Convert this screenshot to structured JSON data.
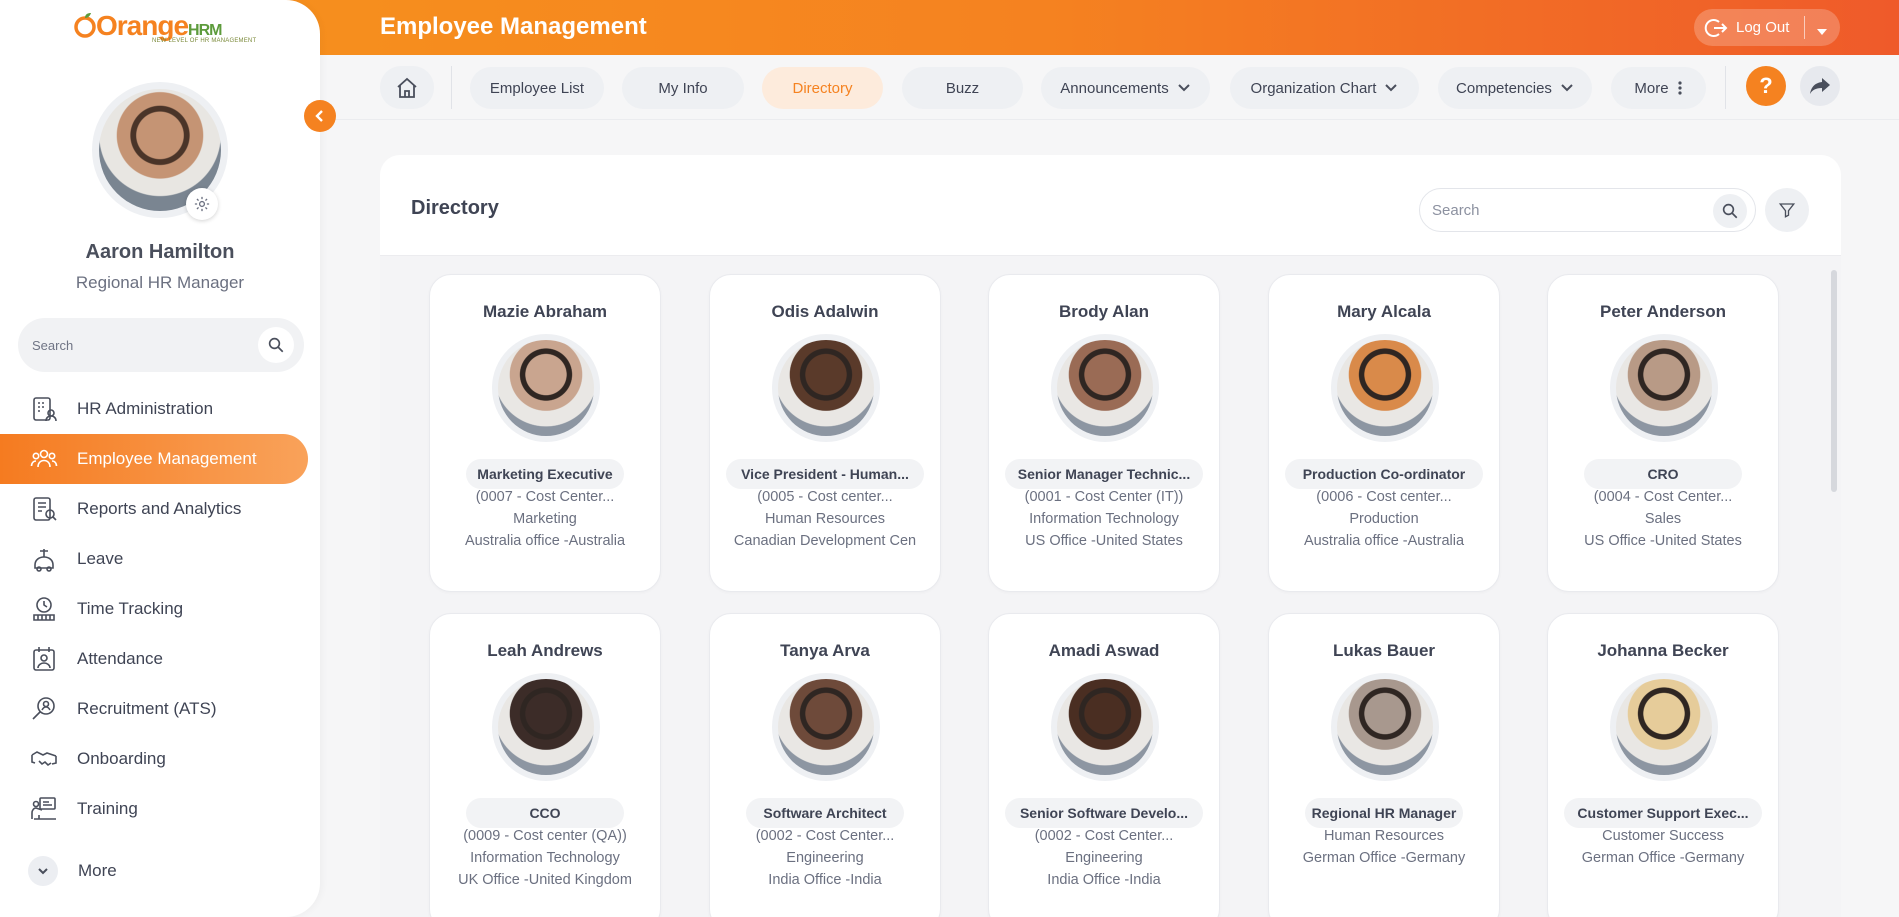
{
  "app": {
    "logo_main": "Orange",
    "logo_suffix": "HRM",
    "logo_tagline": "NEW LEVEL OF HR MANAGEMENT",
    "page_title": "Employee Management",
    "logout_label": "Log Out",
    "accent_color": "#f58220"
  },
  "sidebar": {
    "user_name": "Aaron Hamilton",
    "user_role": "Regional HR Manager",
    "search_placeholder": "Search",
    "items": [
      {
        "label": "HR Administration",
        "icon": "hr-admin-icon",
        "active": false
      },
      {
        "label": "Employee Management",
        "icon": "people-icon",
        "active": true
      },
      {
        "label": "Reports and Analytics",
        "icon": "report-icon",
        "active": false
      },
      {
        "label": "Leave",
        "icon": "leave-icon",
        "active": false
      },
      {
        "label": "Time Tracking",
        "icon": "clock-icon",
        "active": false
      },
      {
        "label": "Attendance",
        "icon": "attendance-icon",
        "active": false
      },
      {
        "label": "Recruitment (ATS)",
        "icon": "recruitment-icon",
        "active": false
      },
      {
        "label": "Onboarding",
        "icon": "handshake-icon",
        "active": false
      },
      {
        "label": "Training",
        "icon": "training-icon",
        "active": false
      }
    ],
    "more_label": "More"
  },
  "tabs": [
    {
      "label": "Employee List",
      "active": false,
      "dropdown": false
    },
    {
      "label": "My Info",
      "active": false,
      "dropdown": false
    },
    {
      "label": "Directory",
      "active": true,
      "dropdown": false
    },
    {
      "label": "Buzz",
      "active": false,
      "dropdown": false
    },
    {
      "label": "Announcements",
      "active": false,
      "dropdown": true
    },
    {
      "label": "Organization Chart",
      "active": false,
      "dropdown": true
    },
    {
      "label": "Competencies",
      "active": false,
      "dropdown": true
    },
    {
      "label": "More",
      "active": false,
      "dropdown": false
    }
  ],
  "help_label": "?",
  "directory": {
    "title": "Directory",
    "search_placeholder": "Search",
    "employees": [
      {
        "name": "Mazie Abraham",
        "job": "Marketing Executive",
        "cost": "(0007 - Cost Center...",
        "dept": "Marketing",
        "location": "Australia office -Australia",
        "photo_color": "#c9a58f"
      },
      {
        "name": "Odis Adalwin",
        "job": "Vice President - Human...",
        "cost": "(0005 - Cost center...",
        "dept": "Human Resources",
        "location": "Canadian Development Cen",
        "photo_color": "#5a3a2a"
      },
      {
        "name": "Brody Alan",
        "job": "Senior Manager Technic...",
        "cost": "(0001 - Cost Center (IT))",
        "dept": "Information Technology",
        "location": "US Office -United States",
        "photo_color": "#9a6b55"
      },
      {
        "name": "Mary Alcala",
        "job": "Production Co-ordinator",
        "cost": "(0006 - Cost center...",
        "dept": "Production",
        "location": "Australia office -Australia",
        "photo_color": "#d98a4a"
      },
      {
        "name": "Peter Anderson",
        "job": "CRO",
        "cost": "(0004 - Cost Center...",
        "dept": "Sales",
        "location": "US Office -United States",
        "photo_color": "#b89a86"
      },
      {
        "name": "Leah Andrews",
        "job": "CCO",
        "cost": "(0009 - Cost center (QA))",
        "dept": "Information Technology",
        "location": "UK Office -United Kingdom",
        "photo_color": "#3c2c28"
      },
      {
        "name": "Tanya Arva",
        "job": "Software Architect",
        "cost": "(0002 - Cost Center...",
        "dept": "Engineering",
        "location": "India Office -India",
        "photo_color": "#6e4a3a"
      },
      {
        "name": "Amadi Aswad",
        "job": "Senior Software Develo...",
        "cost": "(0002 - Cost Center...",
        "dept": "Engineering",
        "location": "India Office -India",
        "photo_color": "#4a2e22"
      },
      {
        "name": "Lukas Bauer",
        "job": "Regional HR Manager",
        "cost": "",
        "dept": "Human Resources",
        "location": "German Office -Germany",
        "photo_color": "#a8988e"
      },
      {
        "name": "Johanna Becker",
        "job": "Customer Support Exec...",
        "cost": "",
        "dept": "Customer Success",
        "location": "German Office -Germany",
        "photo_color": "#e6cc9a"
      }
    ]
  }
}
